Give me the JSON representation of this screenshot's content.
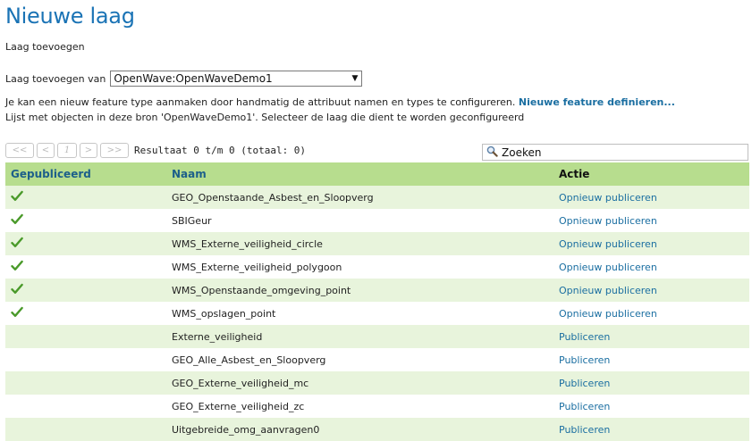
{
  "page": {
    "title": "Nieuwe laag",
    "subtitle": "Laag toevoegen"
  },
  "source": {
    "label": "Laag toevoegen van",
    "selected": "OpenWave:OpenWaveDemo1"
  },
  "description": {
    "text": "Je kan een nieuw feature type aanmaken door handmatig de attribuut namen en types te configureren.",
    "link": "Nieuwe feature definieren...",
    "list_text": "Lijst met objecten in deze bron 'OpenWaveDemo1'. Selecteer de laag die dient te worden geconfigureerd"
  },
  "pager": {
    "first": "<<",
    "prev": "<",
    "page": "1",
    "next": ">",
    "last": ">>",
    "result_text": "Resultaat 0 t/m 0 (totaal: 0)"
  },
  "search": {
    "placeholder": "Zoeken",
    "icon": "search-icon"
  },
  "table": {
    "headers": [
      "Gepubliceerd",
      "Naam",
      "Actie"
    ],
    "rows": [
      {
        "published": true,
        "name": "GEO_Openstaande_Asbest_en_Sloopverg",
        "action": "Opnieuw publiceren"
      },
      {
        "published": true,
        "name": "SBIGeur",
        "action": "Opnieuw publiceren"
      },
      {
        "published": true,
        "name": "WMS_Externe_veiligheid_circle",
        "action": "Opnieuw publiceren"
      },
      {
        "published": true,
        "name": "WMS_Externe_veiligheid_polygoon",
        "action": "Opnieuw publiceren"
      },
      {
        "published": true,
        "name": "WMS_Openstaande_omgeving_point",
        "action": "Opnieuw publiceren"
      },
      {
        "published": true,
        "name": "WMS_opslagen_point",
        "action": "Opnieuw publiceren"
      },
      {
        "published": false,
        "name": "Externe_veiligheid",
        "action": "Publiceren"
      },
      {
        "published": false,
        "name": "GEO_Alle_Asbest_en_Sloopverg",
        "action": "Publiceren"
      },
      {
        "published": false,
        "name": "GEO_Externe_veiligheid_mc",
        "action": "Publiceren"
      },
      {
        "published": false,
        "name": "GEO_Externe_veiligheid_zc",
        "action": "Publiceren"
      },
      {
        "published": false,
        "name": "Uitgebreide_omg_aanvragen0",
        "action": "Publiceren"
      }
    ]
  },
  "colors": {
    "title": "#1a73b5",
    "header_bg": "#b7dd8e",
    "row_alt_bg": "#e8f4dc",
    "link": "#1a6ea1",
    "check": "#4a9a2a"
  }
}
